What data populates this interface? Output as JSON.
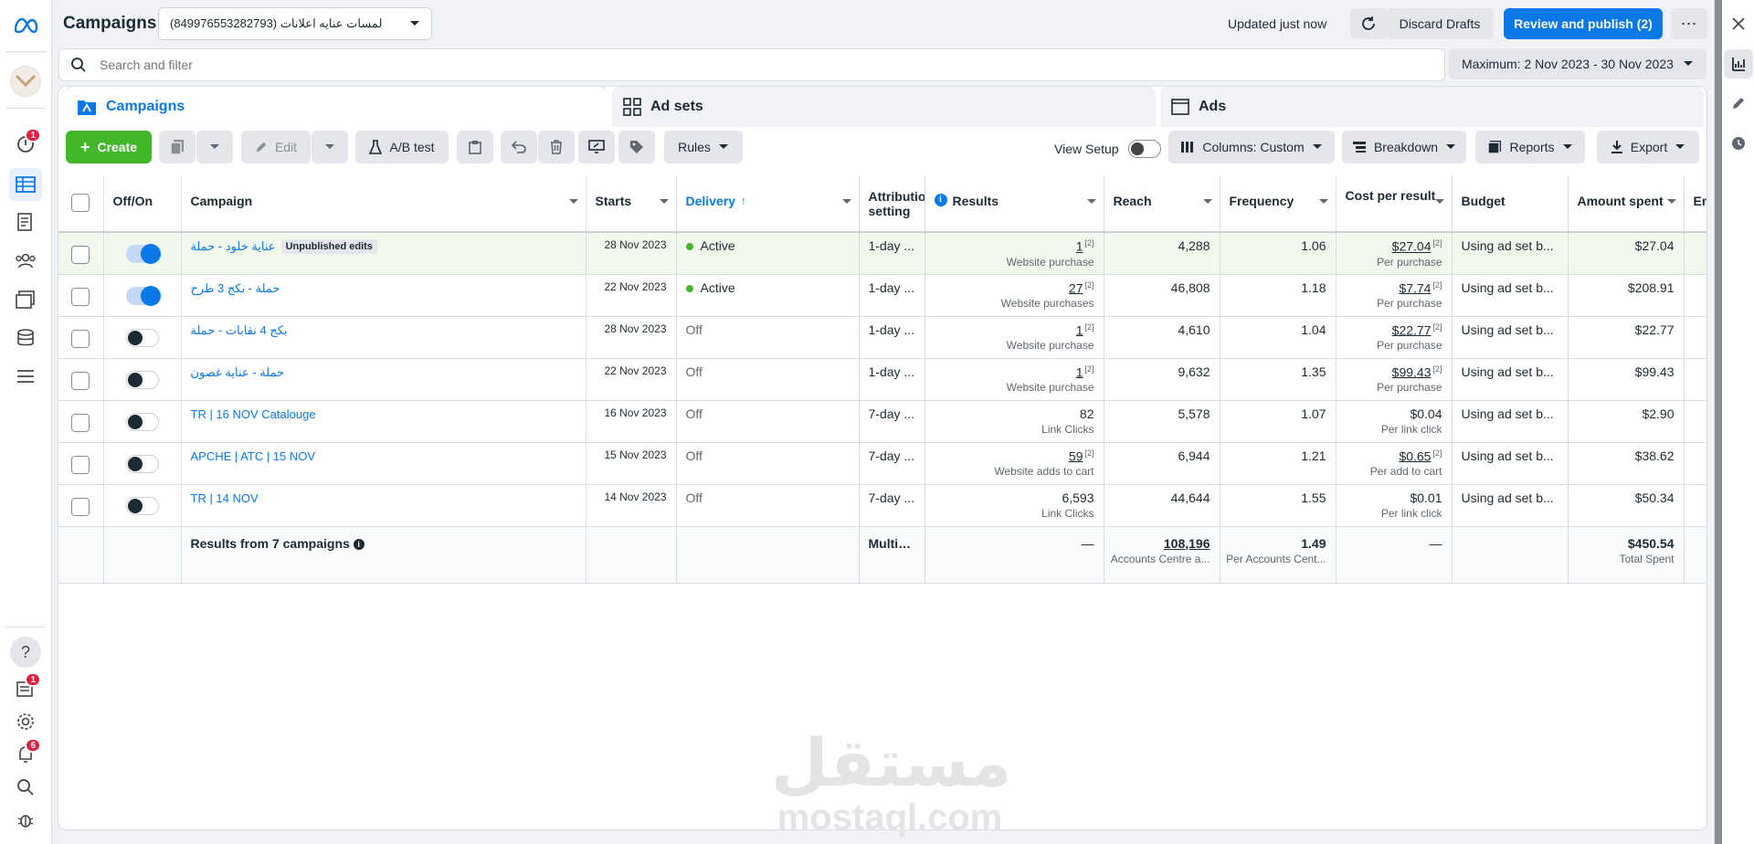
{
  "header": {
    "title": "Campaigns",
    "account_selector": "لمسات عنايه اعلانات (849976553282793)",
    "updated_status": "Updated just now",
    "discard_label": "Discard Drafts",
    "review_label": "Review and publish (2)"
  },
  "left_rail": {
    "badges": {
      "alerts": "1",
      "news": "1",
      "notifications": "6"
    }
  },
  "search": {
    "placeholder": "Search and filter"
  },
  "date_range": {
    "label": "Maximum: 2 Nov 2023 - 30 Nov 2023"
  },
  "level_tabs": {
    "campaigns": "Campaigns",
    "adsets": "Ad sets",
    "ads": "Ads"
  },
  "toolbar": {
    "create": "Create",
    "edit": "Edit",
    "ab_test": "A/B test",
    "rules": "Rules",
    "view_setup": "View Setup",
    "columns": "Columns: Custom",
    "breakdown": "Breakdown",
    "reports": "Reports",
    "export": "Export"
  },
  "table": {
    "columns": {
      "onoff": "Off/On",
      "campaign": "Campaign",
      "starts": "Starts",
      "delivery": "Delivery",
      "attribution": "Attribution setting",
      "results": "Results",
      "reach": "Reach",
      "frequency": "Frequency",
      "cpr": "Cost per result",
      "budget": "Budget",
      "amount_spent": "Amount spent",
      "ends": "Ends"
    },
    "rows": [
      {
        "name": "عناية خلود - حملة",
        "badge": "Unpublished edits",
        "on": true,
        "starts": "28 Nov 2023",
        "delivery": "Active",
        "attribution": "1-day ...",
        "results": "1",
        "results_note": "[2]",
        "results_sub": "Website purchase",
        "reach": "4,288",
        "frequency": "1.06",
        "cpr": "$27.04",
        "cpr_note": "[2]",
        "cpr_sub": "Per purchase",
        "budget": "Using ad set b...",
        "spent": "$27.04"
      },
      {
        "name": "حملة - بكج 3 طرح",
        "badge": "",
        "on": true,
        "starts": "22 Nov 2023",
        "delivery": "Active",
        "attribution": "1-day ...",
        "results": "27",
        "results_note": "[2]",
        "results_sub": "Website purchases",
        "reach": "46,808",
        "frequency": "1.18",
        "cpr": "$7.74",
        "cpr_note": "[2]",
        "cpr_sub": "Per purchase",
        "budget": "Using ad set b...",
        "spent": "$208.91"
      },
      {
        "name": "بكج 4 نقابات - حملة",
        "badge": "",
        "on": false,
        "starts": "28 Nov 2023",
        "delivery": "Off",
        "attribution": "1-day ...",
        "results": "1",
        "results_note": "[2]",
        "results_sub": "Website purchase",
        "reach": "4,610",
        "frequency": "1.04",
        "cpr": "$22.77",
        "cpr_note": "[2]",
        "cpr_sub": "Per purchase",
        "budget": "Using ad set b...",
        "spent": "$22.77"
      },
      {
        "name": "حملة - عناية غصون",
        "badge": "",
        "on": false,
        "starts": "22 Nov 2023",
        "delivery": "Off",
        "attribution": "1-day ...",
        "results": "1",
        "results_note": "[2]",
        "results_sub": "Website purchase",
        "reach": "9,632",
        "frequency": "1.35",
        "cpr": "$99.43",
        "cpr_note": "[2]",
        "cpr_sub": "Per purchase",
        "budget": "Using ad set b...",
        "spent": "$99.43"
      },
      {
        "name": "TR | 16 NOV Catalouge",
        "badge": "",
        "on": false,
        "starts": "16 Nov 2023",
        "delivery": "Off",
        "attribution": "7-day ...",
        "results": "82",
        "results_note": "",
        "results_sub": "Link Clicks",
        "reach": "5,578",
        "frequency": "1.07",
        "cpr": "$0.04",
        "cpr_note": "",
        "cpr_sub": "Per link click",
        "budget": "Using ad set b...",
        "spent": "$2.90"
      },
      {
        "name": "APCHE | ATC | 15 NOV",
        "badge": "",
        "on": false,
        "starts": "15 Nov 2023",
        "delivery": "Off",
        "attribution": "7-day ...",
        "results": "59",
        "results_note": "[2]",
        "results_sub": "Website adds to cart",
        "reach": "6,944",
        "frequency": "1.21",
        "cpr": "$0.65",
        "cpr_note": "[2]",
        "cpr_sub": "Per add to cart",
        "budget": "Using ad set b...",
        "spent": "$38.62"
      },
      {
        "name": "TR | 14 NOV",
        "badge": "",
        "on": false,
        "starts": "14 Nov 2023",
        "delivery": "Off",
        "attribution": "7-day ...",
        "results": "6,593",
        "results_note": "",
        "results_sub": "Link Clicks",
        "reach": "44,644",
        "frequency": "1.55",
        "cpr": "$0.01",
        "cpr_note": "",
        "cpr_sub": "Per link click",
        "budget": "Using ad set b...",
        "spent": "$50.34"
      }
    ],
    "footer": {
      "label": "Results from 7 campaigns",
      "attribution": "Multipl...",
      "results": "—",
      "reach": "108,196",
      "reach_sub": "Accounts Centre a...",
      "frequency": "1.49",
      "frequency_sub": "Per Accounts Cent...",
      "cpr": "—",
      "spent": "$450.54",
      "spent_sub": "Total Spent"
    }
  },
  "watermark": {
    "arabic": "مستقل",
    "latin": "mostaql.com"
  },
  "colors": {
    "accent": "#0a78e6",
    "create": "#42b72a",
    "active_dot": "#42b72a",
    "badge": "#e41e3f"
  }
}
